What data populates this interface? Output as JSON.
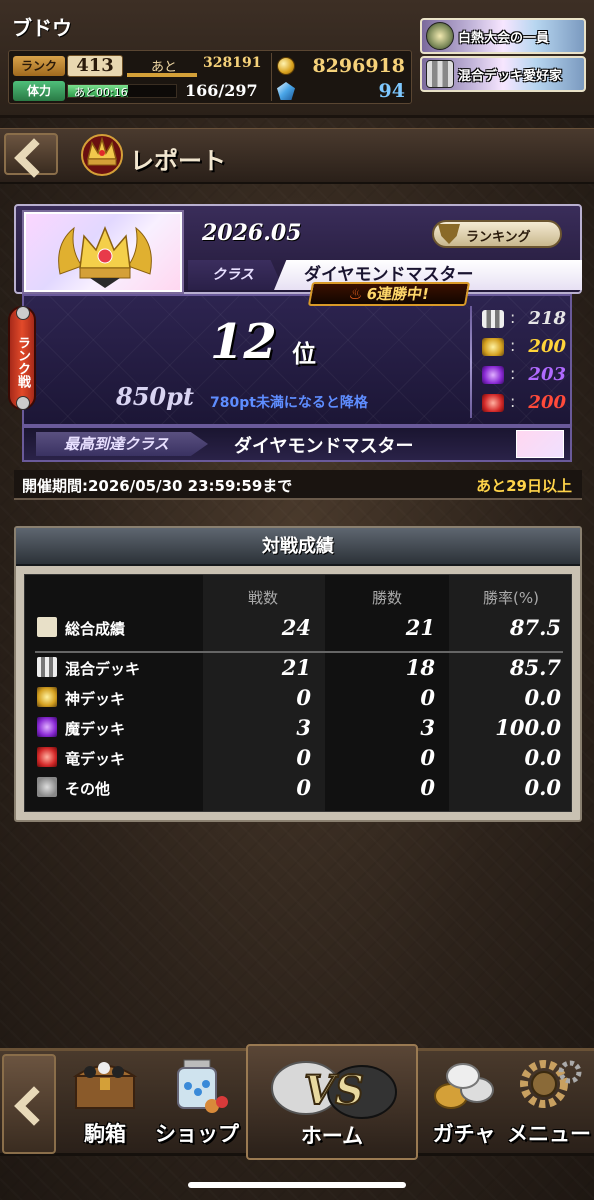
{
  "header": {
    "player_name": "ブドウ",
    "rank_label": "ランク",
    "rank": "413",
    "next_label": "あと",
    "exp_to_next": "328191",
    "stamina_label": "体力",
    "stamina_timer": "あと00:16",
    "stamina": "166/297",
    "stamina_fraction": 0.56,
    "coins": "8296918",
    "gems": "94",
    "titles": [
      "白熱大会の一員",
      "混合デッキ愛好家"
    ]
  },
  "titlebar": {
    "page_title": "レポート"
  },
  "report": {
    "month": "2026.05",
    "ranking_button": "ランキング",
    "class_label": "クラス",
    "class_value": "ダイヤモンドマスター",
    "streak": "6連勝中!",
    "side_tab": "ランク戦",
    "rank_number": "12",
    "rank_suffix": "位",
    "points": "850pt",
    "demote_note": "780pt未満になると降格",
    "deck_stats": [
      {
        "icon": "mixed-deck-icon",
        "value": "218",
        "color": "#e6e6e6"
      },
      {
        "icon": "god-deck-icon",
        "value": "200",
        "color": "#ffd43a"
      },
      {
        "icon": "demon-deck-icon",
        "value": "203",
        "color": "#b06aff"
      },
      {
        "icon": "dragon-deck-icon",
        "value": "200",
        "color": "#ff4a3a"
      }
    ],
    "best_class_label": "最高到達クラス",
    "best_class_value": "ダイヤモンドマスター",
    "period": "開催期間:2026/05/30 23:59:59まで",
    "remaining": "あと29日以上"
  },
  "record": {
    "title": "対戦成績",
    "headers": [
      "戦数",
      "勝数",
      "勝率(%)"
    ],
    "rows": [
      {
        "icon": "total-stats-icon",
        "name": "総合成績",
        "battles": "24",
        "wins": "21",
        "rate": "87.5"
      },
      {
        "icon": "mixed-deck-icon",
        "name": "混合デッキ",
        "battles": "21",
        "wins": "18",
        "rate": "85.7"
      },
      {
        "icon": "god-deck-icon",
        "name": "神デッキ",
        "battles": "0",
        "wins": "0",
        "rate": "0.0"
      },
      {
        "icon": "demon-deck-icon",
        "name": "魔デッキ",
        "battles": "3",
        "wins": "3",
        "rate": "100.0"
      },
      {
        "icon": "dragon-deck-icon",
        "name": "竜デッキ",
        "battles": "0",
        "wins": "0",
        "rate": "0.0"
      },
      {
        "icon": "other-icon",
        "name": "その他",
        "battles": "0",
        "wins": "0",
        "rate": "0.0"
      }
    ]
  },
  "nav": {
    "items": [
      "駒箱",
      "ショップ",
      "ホーム",
      "ガチャ",
      "メニュー"
    ]
  }
}
